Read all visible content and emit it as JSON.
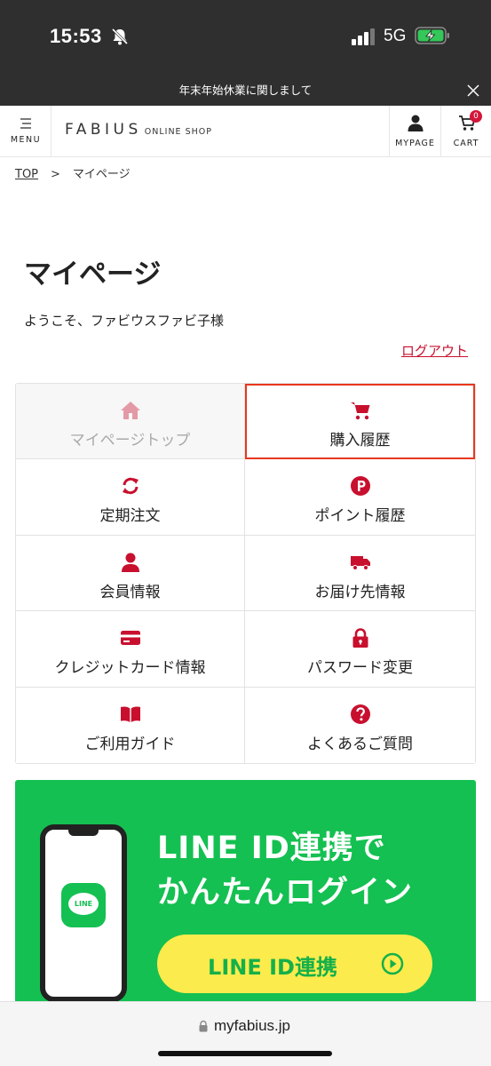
{
  "status": {
    "time": "15:53",
    "network": "5G"
  },
  "notice": {
    "text": "年末年始休業に関しまして"
  },
  "header": {
    "menu_label": "MENU",
    "logo_main": "FABIUS",
    "logo_sub": "ONLINE SHOP",
    "mypage_label": "MYPAGE",
    "cart_label": "CART",
    "cart_count": "0"
  },
  "breadcrumb": {
    "top": "TOP",
    "separator": ">",
    "current": "マイページ"
  },
  "page": {
    "title": "マイページ",
    "welcome": "ようこそ、ファビウスファビ子様",
    "logout": "ログアウト"
  },
  "menu_grid": [
    {
      "label": "マイページトップ",
      "icon": "home-icon",
      "state": "current"
    },
    {
      "label": "購入履歴",
      "icon": "cart-icon",
      "state": "highlighted"
    },
    {
      "label": "定期注文",
      "icon": "refresh-icon",
      "state": "normal"
    },
    {
      "label": "ポイント履歴",
      "icon": "points-icon",
      "state": "normal"
    },
    {
      "label": "会員情報",
      "icon": "user-icon",
      "state": "normal"
    },
    {
      "label": "お届け先情報",
      "icon": "truck-icon",
      "state": "normal"
    },
    {
      "label": "クレジットカード情報",
      "icon": "credit-card-icon",
      "state": "normal"
    },
    {
      "label": "パスワード変更",
      "icon": "lock-icon",
      "state": "normal"
    },
    {
      "label": "ご利用ガイド",
      "icon": "book-icon",
      "state": "normal"
    },
    {
      "label": "よくあるご質問",
      "icon": "question-icon",
      "state": "normal"
    }
  ],
  "banner": {
    "title_line1": "LINE ID連携で",
    "title_line2": "かんたんログイン",
    "button_label": "LINE ID連携",
    "app_icon_text": "LINE"
  },
  "browser": {
    "url": "myfabius.jp"
  },
  "colors": {
    "accent": "#c8102e",
    "line_green": "#14c051",
    "highlight_border": "#e8371e",
    "banner_button": "#fbeb4d"
  }
}
